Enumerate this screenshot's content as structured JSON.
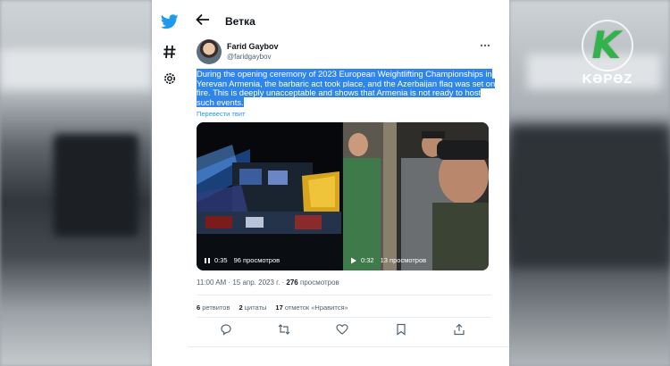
{
  "window": {
    "title": "Ветка"
  },
  "channel_logo": {
    "text": "KƏPƏZ",
    "letter": "K",
    "color": "#2fb34a"
  },
  "nav": {
    "items": [
      {
        "icon": "twitter-bird-icon"
      },
      {
        "icon": "hashtag-icon"
      },
      {
        "icon": "settings-gear-icon"
      }
    ]
  },
  "tweet": {
    "author_name": "Farid Gaybov",
    "author_handle": "@faridgaybov",
    "text": "During the opening ceremony of 2023 European Weightlifting Championships in Yerevan Armenia, the barbaric act took place, and the Azerbaijan flag was set on fire. This is deeply unacceptable and shows that Armenia is not ready to host such events.",
    "translate_label": "Перевести твит",
    "media": [
      {
        "duration": "0:35",
        "views": "96 просмотров"
      },
      {
        "duration": "0:32",
        "views": "13 просмотров"
      }
    ],
    "timestamp": "11:00 AM · 15 апр. 2023 г. · ",
    "view_count": "276",
    "view_label": " просмотров",
    "stats": {
      "retweets_count": "6",
      "retweets_label": " ретвитов",
      "quotes_count": "2",
      "quotes_label": " цитаты",
      "likes_count": "17",
      "likes_label": " отметок «Нравится»"
    }
  },
  "colors": {
    "twitter_blue": "#1d9bf0",
    "highlight": "#2f86e8",
    "text_primary": "#0f1419",
    "text_secondary": "#536471"
  }
}
